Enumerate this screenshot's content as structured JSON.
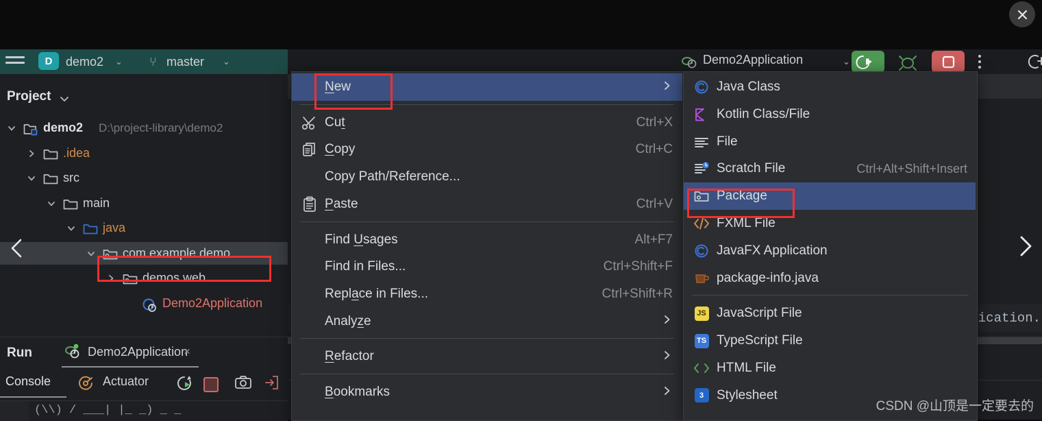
{
  "window": {
    "close_label": "×"
  },
  "toolbar": {
    "menu_icon": "hamburger-icon",
    "project_badge": "D",
    "project_name": "demo2",
    "branch_icon": "branch-icon",
    "branch_name": "master",
    "run_config": "Demo2Application",
    "run_icon": "run-icon",
    "debug_icon": "debug-icon",
    "stop_icon": "stop-icon",
    "more_icon": "more-vertical-icon",
    "far_icon": "add-tab-icon"
  },
  "project_panel": {
    "title": "Project",
    "chevron": "chevron-down-icon",
    "tree": [
      {
        "label": "demo2",
        "path": "D:\\project-library\\demo2",
        "indent": 0,
        "arrow": "down",
        "icon": "module-folder-icon",
        "color": "#dfe2e5",
        "bold": true,
        "selected": false
      },
      {
        "label": ".idea",
        "path": "",
        "indent": 1,
        "arrow": "right",
        "icon": "folder-icon",
        "color": "#cf8e4a",
        "bold": false,
        "selected": false
      },
      {
        "label": "src",
        "path": "",
        "indent": 1,
        "arrow": "down",
        "icon": "folder-icon",
        "color": "#cdd1d5",
        "bold": false,
        "selected": false
      },
      {
        "label": "main",
        "path": "",
        "indent": 2,
        "arrow": "down",
        "icon": "folder-icon",
        "color": "#cdd1d5",
        "bold": false,
        "selected": false
      },
      {
        "label": "java",
        "path": "",
        "indent": 3,
        "arrow": "down",
        "icon": "source-folder-icon",
        "color": "#cf8e4a",
        "bold": false,
        "selected": false
      },
      {
        "label": "com.example.demo",
        "path": "",
        "indent": 4,
        "arrow": "down",
        "icon": "package-icon",
        "color": "#cdd1d5",
        "bold": false,
        "selected": true
      },
      {
        "label": "demos.web",
        "path": "",
        "indent": 5,
        "arrow": "right",
        "icon": "package-icon",
        "color": "#cdd1d5",
        "bold": false,
        "selected": false
      },
      {
        "label": "Demo2Application",
        "path": "",
        "indent": 6,
        "arrow": "none",
        "icon": "spring-class-icon",
        "color": "#e0736b",
        "bold": false,
        "selected": false
      }
    ],
    "nav_prev_icon": "chevron-left-icon",
    "nav_next_icon": "chevron-right-icon"
  },
  "run_panel": {
    "title": "Run",
    "tab_label": "Demo2Application",
    "tab_icon": "spring-run-icon",
    "tab_close": "×",
    "console_label": "Console",
    "actuator_label": "Actuator",
    "actuator_icon": "actuator-icon",
    "rerun_icon": "rerun-icon",
    "stop_icon": "stop-square-icon",
    "camera_icon": "camera-icon",
    "export_icon": "export-icon",
    "console_text": "(\\\\)   /   ___| |_ _) _ _"
  },
  "editor": {
    "code_fragment": ".ication."
  },
  "context_menu": {
    "items": [
      {
        "label": "New",
        "key": "",
        "icon": "",
        "arrow": true,
        "sep_after": true,
        "highlight": true,
        "mnemonic": "N"
      },
      {
        "label": "Cut",
        "key": "Ctrl+X",
        "icon": "scissors-icon",
        "arrow": false,
        "sep_after": false,
        "highlight": false,
        "mnemonic": "t"
      },
      {
        "label": "Copy",
        "key": "Ctrl+C",
        "icon": "copy-icon",
        "arrow": false,
        "sep_after": false,
        "highlight": false,
        "mnemonic": "C"
      },
      {
        "label": "Copy Path/Reference...",
        "key": "",
        "icon": "",
        "arrow": false,
        "sep_after": false,
        "highlight": false,
        "mnemonic": ""
      },
      {
        "label": "Paste",
        "key": "Ctrl+V",
        "icon": "paste-icon",
        "arrow": false,
        "sep_after": true,
        "highlight": false,
        "mnemonic": "P"
      },
      {
        "label": "Find Usages",
        "key": "Alt+F7",
        "icon": "",
        "arrow": false,
        "sep_after": false,
        "highlight": false,
        "mnemonic": "U"
      },
      {
        "label": "Find in Files...",
        "key": "Ctrl+Shift+F",
        "icon": "",
        "arrow": false,
        "sep_after": false,
        "highlight": false,
        "mnemonic": ""
      },
      {
        "label": "Replace in Files...",
        "key": "Ctrl+Shift+R",
        "icon": "",
        "arrow": false,
        "sep_after": false,
        "highlight": false,
        "mnemonic": "a"
      },
      {
        "label": "Analyze",
        "key": "",
        "icon": "",
        "arrow": true,
        "sep_after": true,
        "highlight": false,
        "mnemonic": "z"
      },
      {
        "label": "Refactor",
        "key": "",
        "icon": "",
        "arrow": true,
        "sep_after": true,
        "highlight": false,
        "mnemonic": "R"
      },
      {
        "label": "Bookmarks",
        "key": "",
        "icon": "",
        "arrow": true,
        "sep_after": false,
        "highlight": false,
        "mnemonic": "B"
      }
    ]
  },
  "submenu": {
    "items": [
      {
        "label": "Java Class",
        "key": "",
        "icon": "java-class-icon",
        "sep_after": false,
        "highlight": false
      },
      {
        "label": "Kotlin Class/File",
        "key": "",
        "icon": "kotlin-icon",
        "sep_after": false,
        "highlight": false
      },
      {
        "label": "File",
        "key": "",
        "icon": "file-icon",
        "sep_after": false,
        "highlight": false
      },
      {
        "label": "Scratch File",
        "key": "Ctrl+Alt+Shift+Insert",
        "icon": "scratch-file-icon",
        "sep_after": false,
        "highlight": false
      },
      {
        "label": "Package",
        "key": "",
        "icon": "package-icon",
        "sep_after": false,
        "highlight": true
      },
      {
        "label": "FXML File",
        "key": "",
        "icon": "fxml-icon",
        "sep_after": false,
        "highlight": false
      },
      {
        "label": "JavaFX Application",
        "key": "",
        "icon": "javafx-icon",
        "sep_after": false,
        "highlight": false
      },
      {
        "label": "package-info.java",
        "key": "",
        "icon": "java-cup-icon",
        "sep_after": true,
        "highlight": false
      },
      {
        "label": "JavaScript File",
        "key": "",
        "icon": "js-icon",
        "sep_after": false,
        "highlight": false
      },
      {
        "label": "TypeScript File",
        "key": "",
        "icon": "ts-icon",
        "sep_after": false,
        "highlight": false
      },
      {
        "label": "HTML File",
        "key": "",
        "icon": "html-icon",
        "sep_after": false,
        "highlight": false
      },
      {
        "label": "Stylesheet",
        "key": "",
        "icon": "css-icon",
        "sep_after": false,
        "highlight": false
      }
    ]
  },
  "annotations": {
    "new_box": "red-highlight-new",
    "package_box": "red-highlight-package",
    "tree_box": "red-highlight-com-example-demo"
  },
  "watermark": "CSDN @山顶是一定要去的",
  "colors": {
    "menu_bg": "#2b2d30",
    "highlight_blue": "#3c5182",
    "annotation_red": "#f03030",
    "toolbar_teal": "#1f4542"
  }
}
